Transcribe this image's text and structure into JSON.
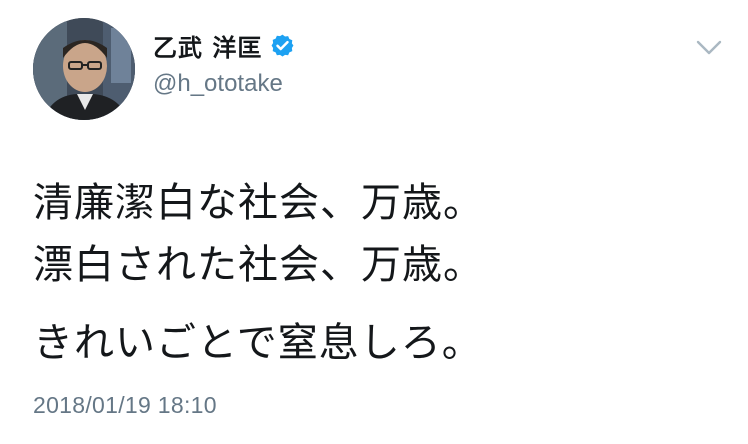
{
  "user": {
    "display_name": "乙武 洋匡",
    "handle": "@h_ototake",
    "verified_icon": "verified-badge-icon",
    "avatar_icon": "avatar"
  },
  "tweet": {
    "lines": [
      "清廉潔白な社会、万歳。",
      "漂白された社会、万歳。",
      "きれいごとで窒息しろ。"
    ],
    "timestamp": "2018/01/19 18:10"
  },
  "menu": {
    "icon": "chevron-down-icon"
  },
  "colors": {
    "text": "#14171a",
    "secondary": "#657786",
    "verified": "#1da1f2",
    "chevron": "#aab8c2"
  }
}
